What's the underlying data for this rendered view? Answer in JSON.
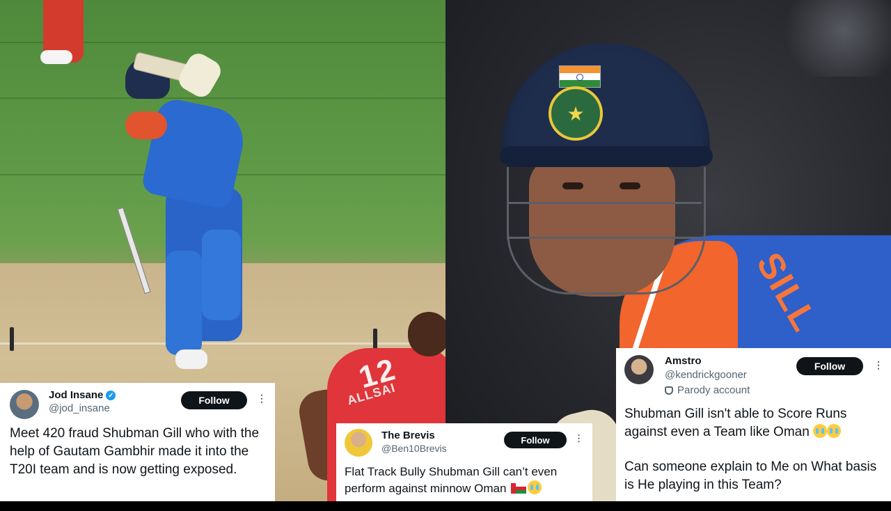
{
  "tweets": {
    "t1": {
      "name": "Jod Insane",
      "handle": "@jod_insane",
      "verified": true,
      "follow_label": "Follow",
      "body": "Meet 420 fraud Shubman Gill who with the help of Gautam Gambhir made it into the T20I team and is now getting exposed."
    },
    "t2": {
      "name": "The Brevis",
      "handle": "@Ben10Brevis",
      "follow_label": "Follow",
      "body": "Flat Track Bully Shubman Gill can’t even perform against minnow Oman",
      "emojis": [
        "oman-flag",
        "loudly-crying-face"
      ]
    },
    "t3": {
      "name": "Amstro",
      "handle": "@kendrickgooner",
      "parody_label": "Parody account",
      "follow_label": "Follow",
      "body_line1": "Shubman Gill isn't able to Score Runs against even a Team like Oman",
      "body_line2": "Can someone explain to Me on What basis is He playing in this Team?",
      "emojis": [
        "loudly-crying-face",
        "loudly-crying-face"
      ]
    }
  },
  "photos": {
    "left": {
      "jersey_number": "12",
      "jersey_name": "ALLSAI"
    },
    "right": {
      "jersey_letters": "SILL"
    }
  },
  "colors": {
    "follow_bg": "#0f1419",
    "handle_text": "#536471",
    "verified_blue": "#1d9bf0",
    "india_blue": "#2f5fc8",
    "india_orange": "#f2652d",
    "oman_red": "#e0353a"
  }
}
